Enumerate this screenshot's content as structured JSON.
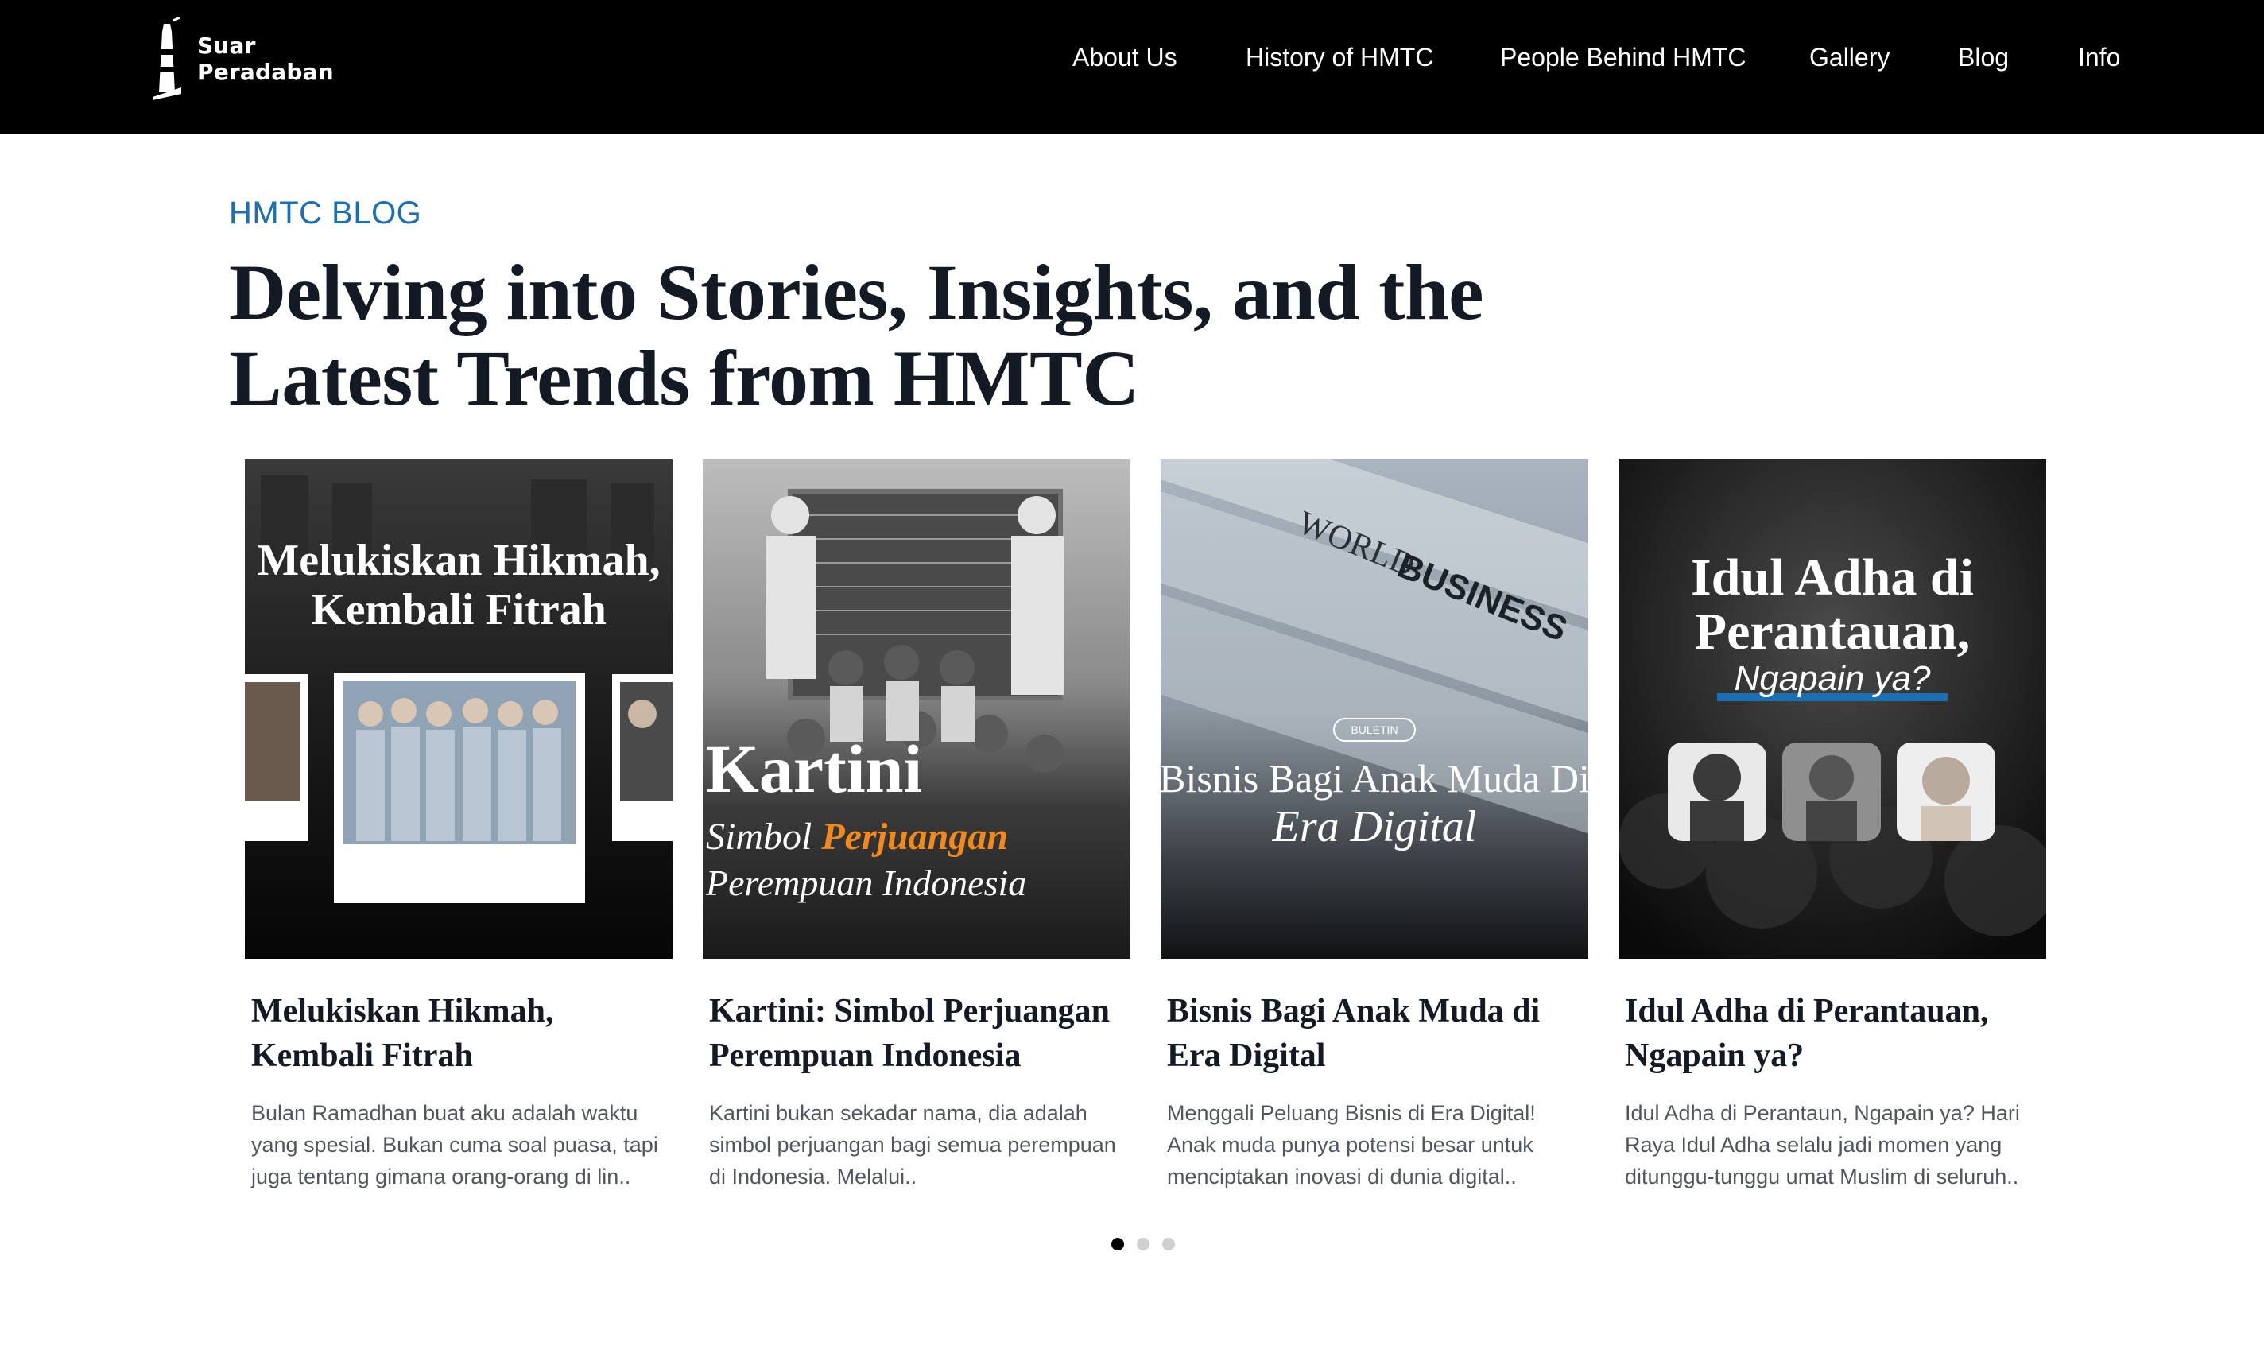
{
  "brand": {
    "name_line1": "Suar",
    "name_line2": "Peradaban"
  },
  "nav": {
    "items": [
      {
        "label": "About Us"
      },
      {
        "label": "History of HMTC"
      },
      {
        "label": "People Behind HMTC"
      },
      {
        "label": "Gallery"
      },
      {
        "label": "Blog"
      },
      {
        "label": "Info"
      }
    ]
  },
  "section": {
    "eyebrow": "HMTC BLOG",
    "headline_line1": "Delving into Stories, Insights, and the",
    "headline_line2": "Latest Trends from HMTC"
  },
  "cards": [
    {
      "title": "Melukiskan Hikmah, Kembali Fitrah",
      "excerpt": "Bulan Ramadhan buat aku adalah waktu yang spesial. Bukan cuma soal puasa, tapi juga tentang gimana orang-orang di lin..",
      "thumb": {
        "line1": "Melukiskan Hikmah,",
        "line2": "Kembali Fitrah"
      }
    },
    {
      "title": "Kartini: Simbol Perjuangan Perempuan Indonesia",
      "excerpt": "Kartini bukan sekadar nama, dia adalah simbol perjuangan bagi semua perempuan di Indonesia. Melalui..",
      "thumb": {
        "big": "Kartini",
        "line2a": "Simbol ",
        "line2b": "Perjuangan",
        "line3": "Perempuan Indonesia"
      }
    },
    {
      "title": "Bisnis Bagi Anak Muda di Era Digital",
      "excerpt": "Menggali Peluang Bisnis di Era Digital! Anak muda punya potensi besar untuk menciptakan inovasi di dunia digital..",
      "thumb": {
        "badge": "BULETIN",
        "line1": "Bisnis Bagi Anak Muda Di",
        "line2": "Era Digital",
        "paper1": "WORLD",
        "paper2": "BUSINESS"
      }
    },
    {
      "title": "Idul Adha di Perantauan, Ngapain ya?",
      "excerpt": "Idul Adha di Perantaun, Ngapain ya? Hari Raya Idul Adha selalu jadi momen yang ditunggu-tunggu umat Muslim di seluruh..",
      "thumb": {
        "line1": "Idul Adha di",
        "line2": "Perantauan,",
        "line3": "Ngapain ya?"
      }
    }
  ],
  "pagination": {
    "count": 3,
    "active_index": 0
  },
  "colors": {
    "accent": "#1a6fb5",
    "nav_bg": "#000000",
    "headline": "#141a24",
    "orange": "#f08a1c"
  }
}
